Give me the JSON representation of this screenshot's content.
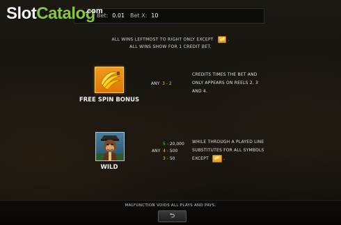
{
  "logo": {
    "part1": "Slot",
    "part2": "Catalog",
    "suffix": ".com"
  },
  "topbar": {
    "bet_label": "Bet:",
    "bet_value": "0.01",
    "betx_label": "Bet X:",
    "betx_value": "10"
  },
  "rules": {
    "line1": "ALL WINS LEFTMOST TO RIGHT ONLY EXCEPT",
    "line1_suffix": ".",
    "line2": "ALL WINS SHOW FOR 1 CREDIT BET."
  },
  "symbols": [
    {
      "name": "FREE SPIN BONUS",
      "icon": "banana-icon",
      "pays": [
        {
          "prefix": "ANY",
          "count": "3",
          "sep": " - ",
          "value": "2"
        }
      ],
      "desc": [
        "CREDITS TIMES THE BET AND",
        "ONLY APPEARS ON REELS 2, 3",
        "AND 4."
      ]
    },
    {
      "name": "WILD",
      "icon": "monkey-icon",
      "pays": [
        {
          "count": "5",
          "sep": " - ",
          "value": "20,000"
        },
        {
          "prefix": "ANY",
          "count": "4",
          "sep": " - ",
          "value": "500"
        },
        {
          "count": "3",
          "sep": " - ",
          "value": "50"
        }
      ],
      "desc": [
        "WHILE THROUGH A PLAYED LINE",
        "SUBSTITUTES FOR ALL SYMBOLS",
        "EXCEPT"
      ],
      "desc_suffix": "."
    }
  ],
  "footer": {
    "disclaimer": "MALFUNCTION VOIDS ALL PLAYS AND PAYS.",
    "back_icon": "return-arrow-icon",
    "back_glyph": "⮌"
  },
  "colors": {
    "accent_green": "#8cc63f",
    "count_yellow": "#f4c430",
    "count_green": "#7fd24a"
  }
}
